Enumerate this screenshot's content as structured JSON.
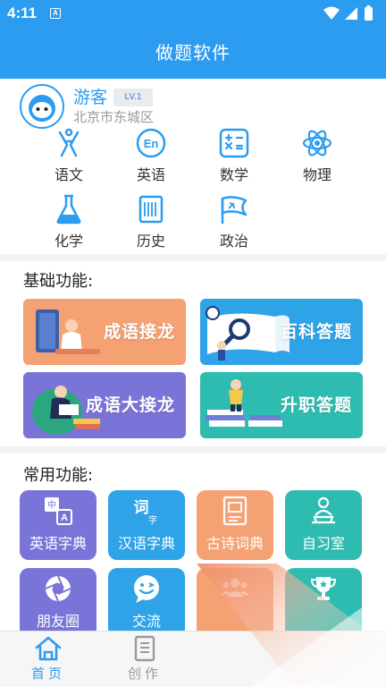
{
  "status": {
    "time": "4:11",
    "notif_glyph": "A"
  },
  "header": {
    "title": "做题软件"
  },
  "user": {
    "name": "游客",
    "level": "LV.1",
    "location": "北京市东城区"
  },
  "subjects": [
    {
      "label": "语文",
      "icon": "pen-nib-icon"
    },
    {
      "label": "英语",
      "icon": "en-circle-icon"
    },
    {
      "label": "数学",
      "icon": "calculator-icon"
    },
    {
      "label": "物理",
      "icon": "atom-icon"
    },
    {
      "label": "化学",
      "icon": "flask-icon"
    },
    {
      "label": "历史",
      "icon": "scroll-icon"
    },
    {
      "label": "政治",
      "icon": "flag-icon"
    }
  ],
  "basic": {
    "title": "基础功能:",
    "cards": [
      {
        "label": "成语接龙",
        "color": "#f4a174"
      },
      {
        "label": "百科答题",
        "color": "#2ea3e8"
      },
      {
        "label": "成语大接龙",
        "color": "#7b74d8"
      },
      {
        "label": "升职答题",
        "color": "#2fbcb0"
      }
    ]
  },
  "common": {
    "title": "常用功能:",
    "tools": [
      {
        "label": "英语字典",
        "color": "#7b74d8",
        "icon": "translate-icon"
      },
      {
        "label": "汉语字典",
        "color": "#2ea3e8",
        "icon": "ci-character-icon",
        "glyph_main": "词",
        "glyph_sub": "字"
      },
      {
        "label": "古诗词典",
        "color": "#f4a174",
        "icon": "book-icon"
      },
      {
        "label": "自习室",
        "color": "#2fbcb0",
        "icon": "reading-person-icon"
      },
      {
        "label": "朋友圈",
        "color": "#7b74d8",
        "icon": "aperture-icon"
      },
      {
        "label": "交流",
        "color": "#2ea3e8",
        "icon": "chat-smile-icon"
      },
      {
        "label": "",
        "color": "#f4a174",
        "icon": "group-icon"
      },
      {
        "label": "",
        "color": "#2fbcb0",
        "icon": "trophy-icon"
      }
    ]
  },
  "nav": {
    "home": {
      "label": "首页",
      "color": "#2b9cf0"
    },
    "create": {
      "label": "创作",
      "color": "#9a9a9a"
    }
  }
}
